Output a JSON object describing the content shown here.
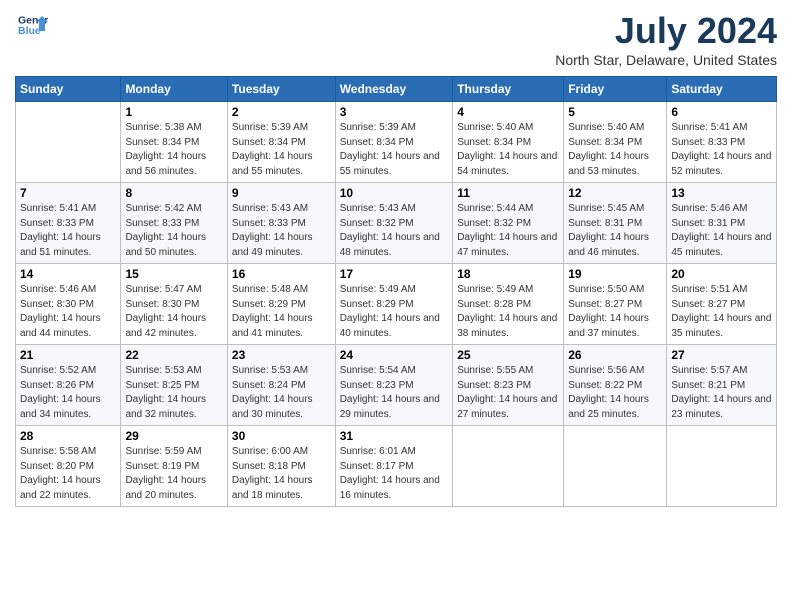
{
  "logo": {
    "line1": "General",
    "line2": "Blue"
  },
  "title": "July 2024",
  "subtitle": "North Star, Delaware, United States",
  "days_header": [
    "Sunday",
    "Monday",
    "Tuesday",
    "Wednesday",
    "Thursday",
    "Friday",
    "Saturday"
  ],
  "weeks": [
    [
      {
        "day": "",
        "sunrise": "",
        "sunset": "",
        "daylight": ""
      },
      {
        "day": "1",
        "sunrise": "Sunrise: 5:38 AM",
        "sunset": "Sunset: 8:34 PM",
        "daylight": "Daylight: 14 hours and 56 minutes."
      },
      {
        "day": "2",
        "sunrise": "Sunrise: 5:39 AM",
        "sunset": "Sunset: 8:34 PM",
        "daylight": "Daylight: 14 hours and 55 minutes."
      },
      {
        "day": "3",
        "sunrise": "Sunrise: 5:39 AM",
        "sunset": "Sunset: 8:34 PM",
        "daylight": "Daylight: 14 hours and 55 minutes."
      },
      {
        "day": "4",
        "sunrise": "Sunrise: 5:40 AM",
        "sunset": "Sunset: 8:34 PM",
        "daylight": "Daylight: 14 hours and 54 minutes."
      },
      {
        "day": "5",
        "sunrise": "Sunrise: 5:40 AM",
        "sunset": "Sunset: 8:34 PM",
        "daylight": "Daylight: 14 hours and 53 minutes."
      },
      {
        "day": "6",
        "sunrise": "Sunrise: 5:41 AM",
        "sunset": "Sunset: 8:33 PM",
        "daylight": "Daylight: 14 hours and 52 minutes."
      }
    ],
    [
      {
        "day": "7",
        "sunrise": "Sunrise: 5:41 AM",
        "sunset": "Sunset: 8:33 PM",
        "daylight": "Daylight: 14 hours and 51 minutes."
      },
      {
        "day": "8",
        "sunrise": "Sunrise: 5:42 AM",
        "sunset": "Sunset: 8:33 PM",
        "daylight": "Daylight: 14 hours and 50 minutes."
      },
      {
        "day": "9",
        "sunrise": "Sunrise: 5:43 AM",
        "sunset": "Sunset: 8:33 PM",
        "daylight": "Daylight: 14 hours and 49 minutes."
      },
      {
        "day": "10",
        "sunrise": "Sunrise: 5:43 AM",
        "sunset": "Sunset: 8:32 PM",
        "daylight": "Daylight: 14 hours and 48 minutes."
      },
      {
        "day": "11",
        "sunrise": "Sunrise: 5:44 AM",
        "sunset": "Sunset: 8:32 PM",
        "daylight": "Daylight: 14 hours and 47 minutes."
      },
      {
        "day": "12",
        "sunrise": "Sunrise: 5:45 AM",
        "sunset": "Sunset: 8:31 PM",
        "daylight": "Daylight: 14 hours and 46 minutes."
      },
      {
        "day": "13",
        "sunrise": "Sunrise: 5:46 AM",
        "sunset": "Sunset: 8:31 PM",
        "daylight": "Daylight: 14 hours and 45 minutes."
      }
    ],
    [
      {
        "day": "14",
        "sunrise": "Sunrise: 5:46 AM",
        "sunset": "Sunset: 8:30 PM",
        "daylight": "Daylight: 14 hours and 44 minutes."
      },
      {
        "day": "15",
        "sunrise": "Sunrise: 5:47 AM",
        "sunset": "Sunset: 8:30 PM",
        "daylight": "Daylight: 14 hours and 42 minutes."
      },
      {
        "day": "16",
        "sunrise": "Sunrise: 5:48 AM",
        "sunset": "Sunset: 8:29 PM",
        "daylight": "Daylight: 14 hours and 41 minutes."
      },
      {
        "day": "17",
        "sunrise": "Sunrise: 5:49 AM",
        "sunset": "Sunset: 8:29 PM",
        "daylight": "Daylight: 14 hours and 40 minutes."
      },
      {
        "day": "18",
        "sunrise": "Sunrise: 5:49 AM",
        "sunset": "Sunset: 8:28 PM",
        "daylight": "Daylight: 14 hours and 38 minutes."
      },
      {
        "day": "19",
        "sunrise": "Sunrise: 5:50 AM",
        "sunset": "Sunset: 8:27 PM",
        "daylight": "Daylight: 14 hours and 37 minutes."
      },
      {
        "day": "20",
        "sunrise": "Sunrise: 5:51 AM",
        "sunset": "Sunset: 8:27 PM",
        "daylight": "Daylight: 14 hours and 35 minutes."
      }
    ],
    [
      {
        "day": "21",
        "sunrise": "Sunrise: 5:52 AM",
        "sunset": "Sunset: 8:26 PM",
        "daylight": "Daylight: 14 hours and 34 minutes."
      },
      {
        "day": "22",
        "sunrise": "Sunrise: 5:53 AM",
        "sunset": "Sunset: 8:25 PM",
        "daylight": "Daylight: 14 hours and 32 minutes."
      },
      {
        "day": "23",
        "sunrise": "Sunrise: 5:53 AM",
        "sunset": "Sunset: 8:24 PM",
        "daylight": "Daylight: 14 hours and 30 minutes."
      },
      {
        "day": "24",
        "sunrise": "Sunrise: 5:54 AM",
        "sunset": "Sunset: 8:23 PM",
        "daylight": "Daylight: 14 hours and 29 minutes."
      },
      {
        "day": "25",
        "sunrise": "Sunrise: 5:55 AM",
        "sunset": "Sunset: 8:23 PM",
        "daylight": "Daylight: 14 hours and 27 minutes."
      },
      {
        "day": "26",
        "sunrise": "Sunrise: 5:56 AM",
        "sunset": "Sunset: 8:22 PM",
        "daylight": "Daylight: 14 hours and 25 minutes."
      },
      {
        "day": "27",
        "sunrise": "Sunrise: 5:57 AM",
        "sunset": "Sunset: 8:21 PM",
        "daylight": "Daylight: 14 hours and 23 minutes."
      }
    ],
    [
      {
        "day": "28",
        "sunrise": "Sunrise: 5:58 AM",
        "sunset": "Sunset: 8:20 PM",
        "daylight": "Daylight: 14 hours and 22 minutes."
      },
      {
        "day": "29",
        "sunrise": "Sunrise: 5:59 AM",
        "sunset": "Sunset: 8:19 PM",
        "daylight": "Daylight: 14 hours and 20 minutes."
      },
      {
        "day": "30",
        "sunrise": "Sunrise: 6:00 AM",
        "sunset": "Sunset: 8:18 PM",
        "daylight": "Daylight: 14 hours and 18 minutes."
      },
      {
        "day": "31",
        "sunrise": "Sunrise: 6:01 AM",
        "sunset": "Sunset: 8:17 PM",
        "daylight": "Daylight: 14 hours and 16 minutes."
      },
      {
        "day": "",
        "sunrise": "",
        "sunset": "",
        "daylight": ""
      },
      {
        "day": "",
        "sunrise": "",
        "sunset": "",
        "daylight": ""
      },
      {
        "day": "",
        "sunrise": "",
        "sunset": "",
        "daylight": ""
      }
    ]
  ]
}
